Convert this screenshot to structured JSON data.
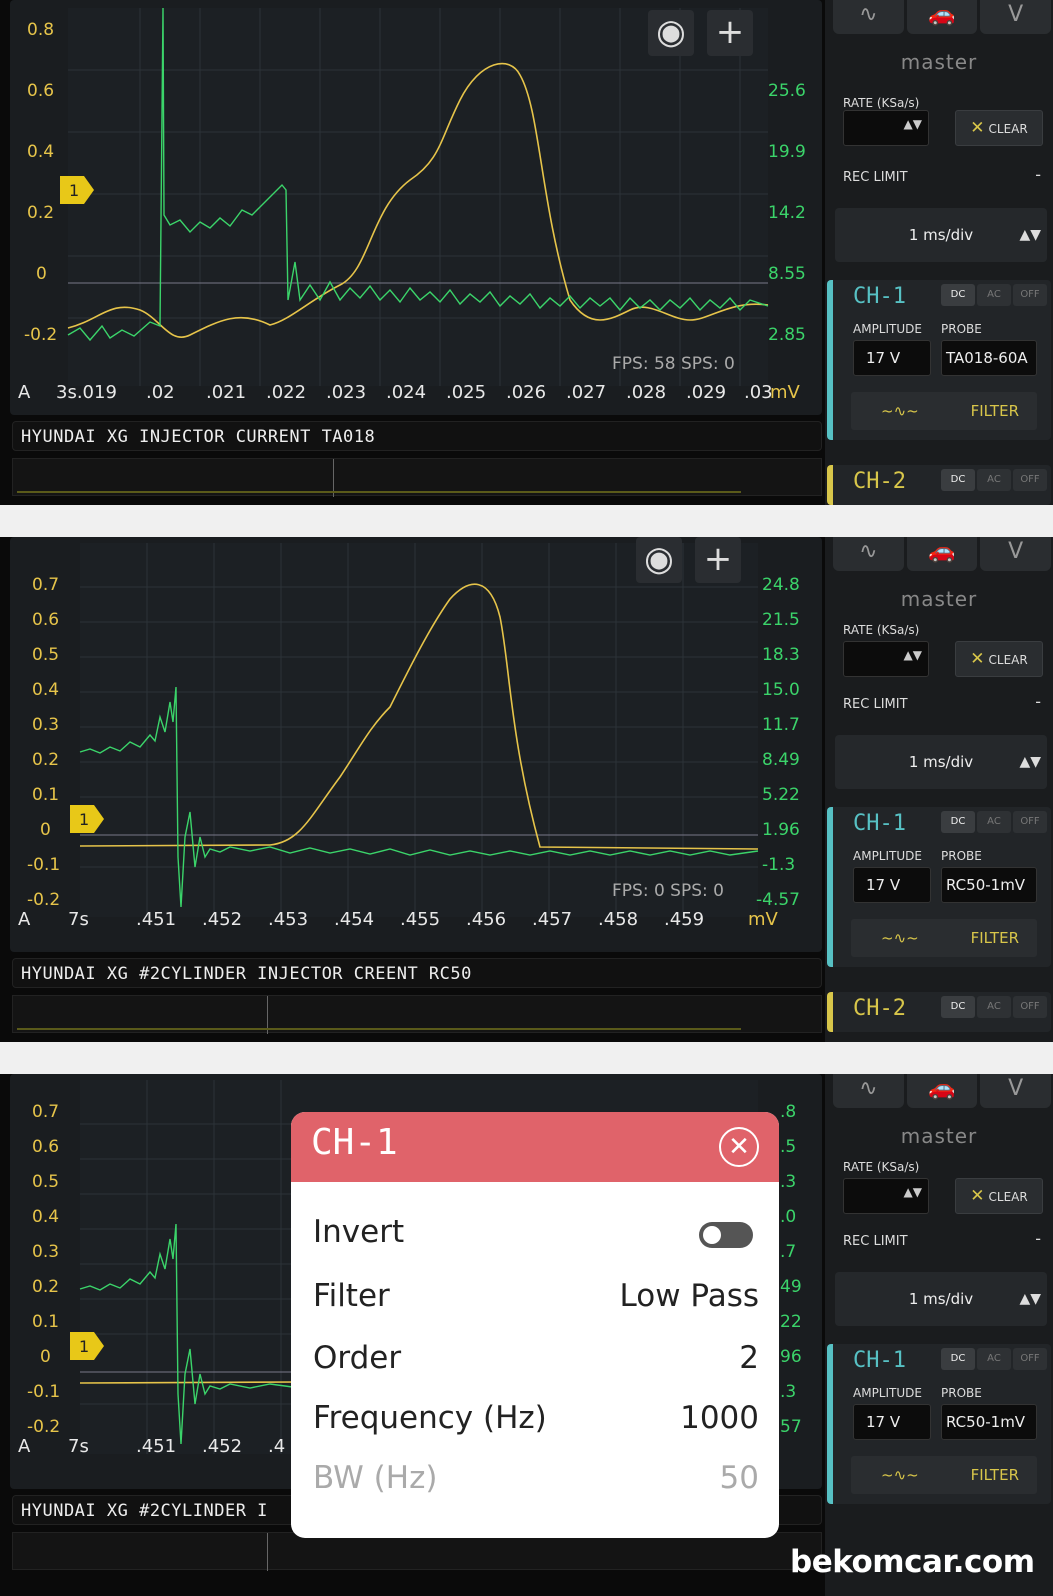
{
  "common": {
    "side": {
      "tabs": [
        "∿",
        "car",
        "V"
      ],
      "master": "master",
      "rate_label": "RATE (KSa/s)",
      "clear_label": "CLEAR",
      "rec_limit_label": "REC LIMIT",
      "rec_limit_value": "-",
      "timebase": "1 ms/div",
      "ch1": "CH-1",
      "ch2": "CH-2",
      "coupling": [
        "DC",
        "AC",
        "OFF"
      ],
      "amplitude_label": "AMPLITUDE",
      "probe_label": "PROBE",
      "amplitude": "17 V",
      "filter_label": "FILTER"
    },
    "marker_label": "1",
    "colors": {
      "ch1": "#e6c44a",
      "ch2": "#3bd46a",
      "accent": "#57c1c4",
      "modal_header": "#e0636a"
    }
  },
  "panels": [
    {
      "caption": "HYUNDAI XG INJECTOR CURRENT TA018",
      "probe": "TA018-60A",
      "fps": "FPS: 58  SPS: 0",
      "y_left": [
        "0.8",
        "0.6",
        "0.4",
        "0.2",
        "0",
        "-0.2"
      ],
      "y_right": [
        "25.6",
        "19.9",
        "14.2",
        "8.55",
        "2.85"
      ],
      "x_prefix": "A",
      "x_ticks": [
        "3s.019",
        ".02",
        ".021",
        ".022",
        ".023",
        ".024",
        ".025",
        ".026",
        ".027",
        ".028",
        ".029",
        ".03"
      ],
      "x_unit": "mV"
    },
    {
      "caption": "HYUNDAI XG #2CYLINDER INJECTOR CREENT RC50",
      "probe": "RC50-1mV",
      "fps": "FPS: 0  SPS: 0",
      "y_left": [
        "0.7",
        "0.6",
        "0.5",
        "0.4",
        "0.3",
        "0.2",
        "0.1",
        "0",
        "-0.1",
        "-0.2"
      ],
      "y_right": [
        "24.8",
        "21.5",
        "18.3",
        "15.0",
        "11.7",
        "8.49",
        "5.22",
        "1.96",
        "-1.3",
        "-4.57"
      ],
      "x_prefix": "A",
      "x_ticks": [
        "7s",
        ".451",
        ".452",
        ".453",
        ".454",
        ".455",
        ".456",
        ".457",
        ".458",
        ".459"
      ],
      "x_unit": "mV"
    },
    {
      "caption": "HYUNDAI XG #2CYLINDER I",
      "probe": "RC50-1mV",
      "y_left": [
        "0.7",
        "0.6",
        "0.5",
        "0.4",
        "0.3",
        "0.2",
        "0.1",
        "0",
        "-0.1",
        "-0.2"
      ],
      "y_right": [
        ".8",
        ".5",
        ".3",
        ".0",
        ".7",
        "49",
        "22",
        "96",
        ".3",
        "57"
      ],
      "x_prefix": "A",
      "x_ticks": [
        "7s",
        ".451",
        ".452",
        ".4"
      ]
    }
  ],
  "modal": {
    "title": "CH-1",
    "invert_label": "Invert",
    "filter_label": "Filter",
    "filter_value": "Low Pass",
    "order_label": "Order",
    "order_value": "2",
    "freq_label": "Frequency (Hz)",
    "freq_value": "1000",
    "bw_label": "BW (Hz)",
    "bw_value": "50"
  },
  "watermark": "bekomcar.com"
}
